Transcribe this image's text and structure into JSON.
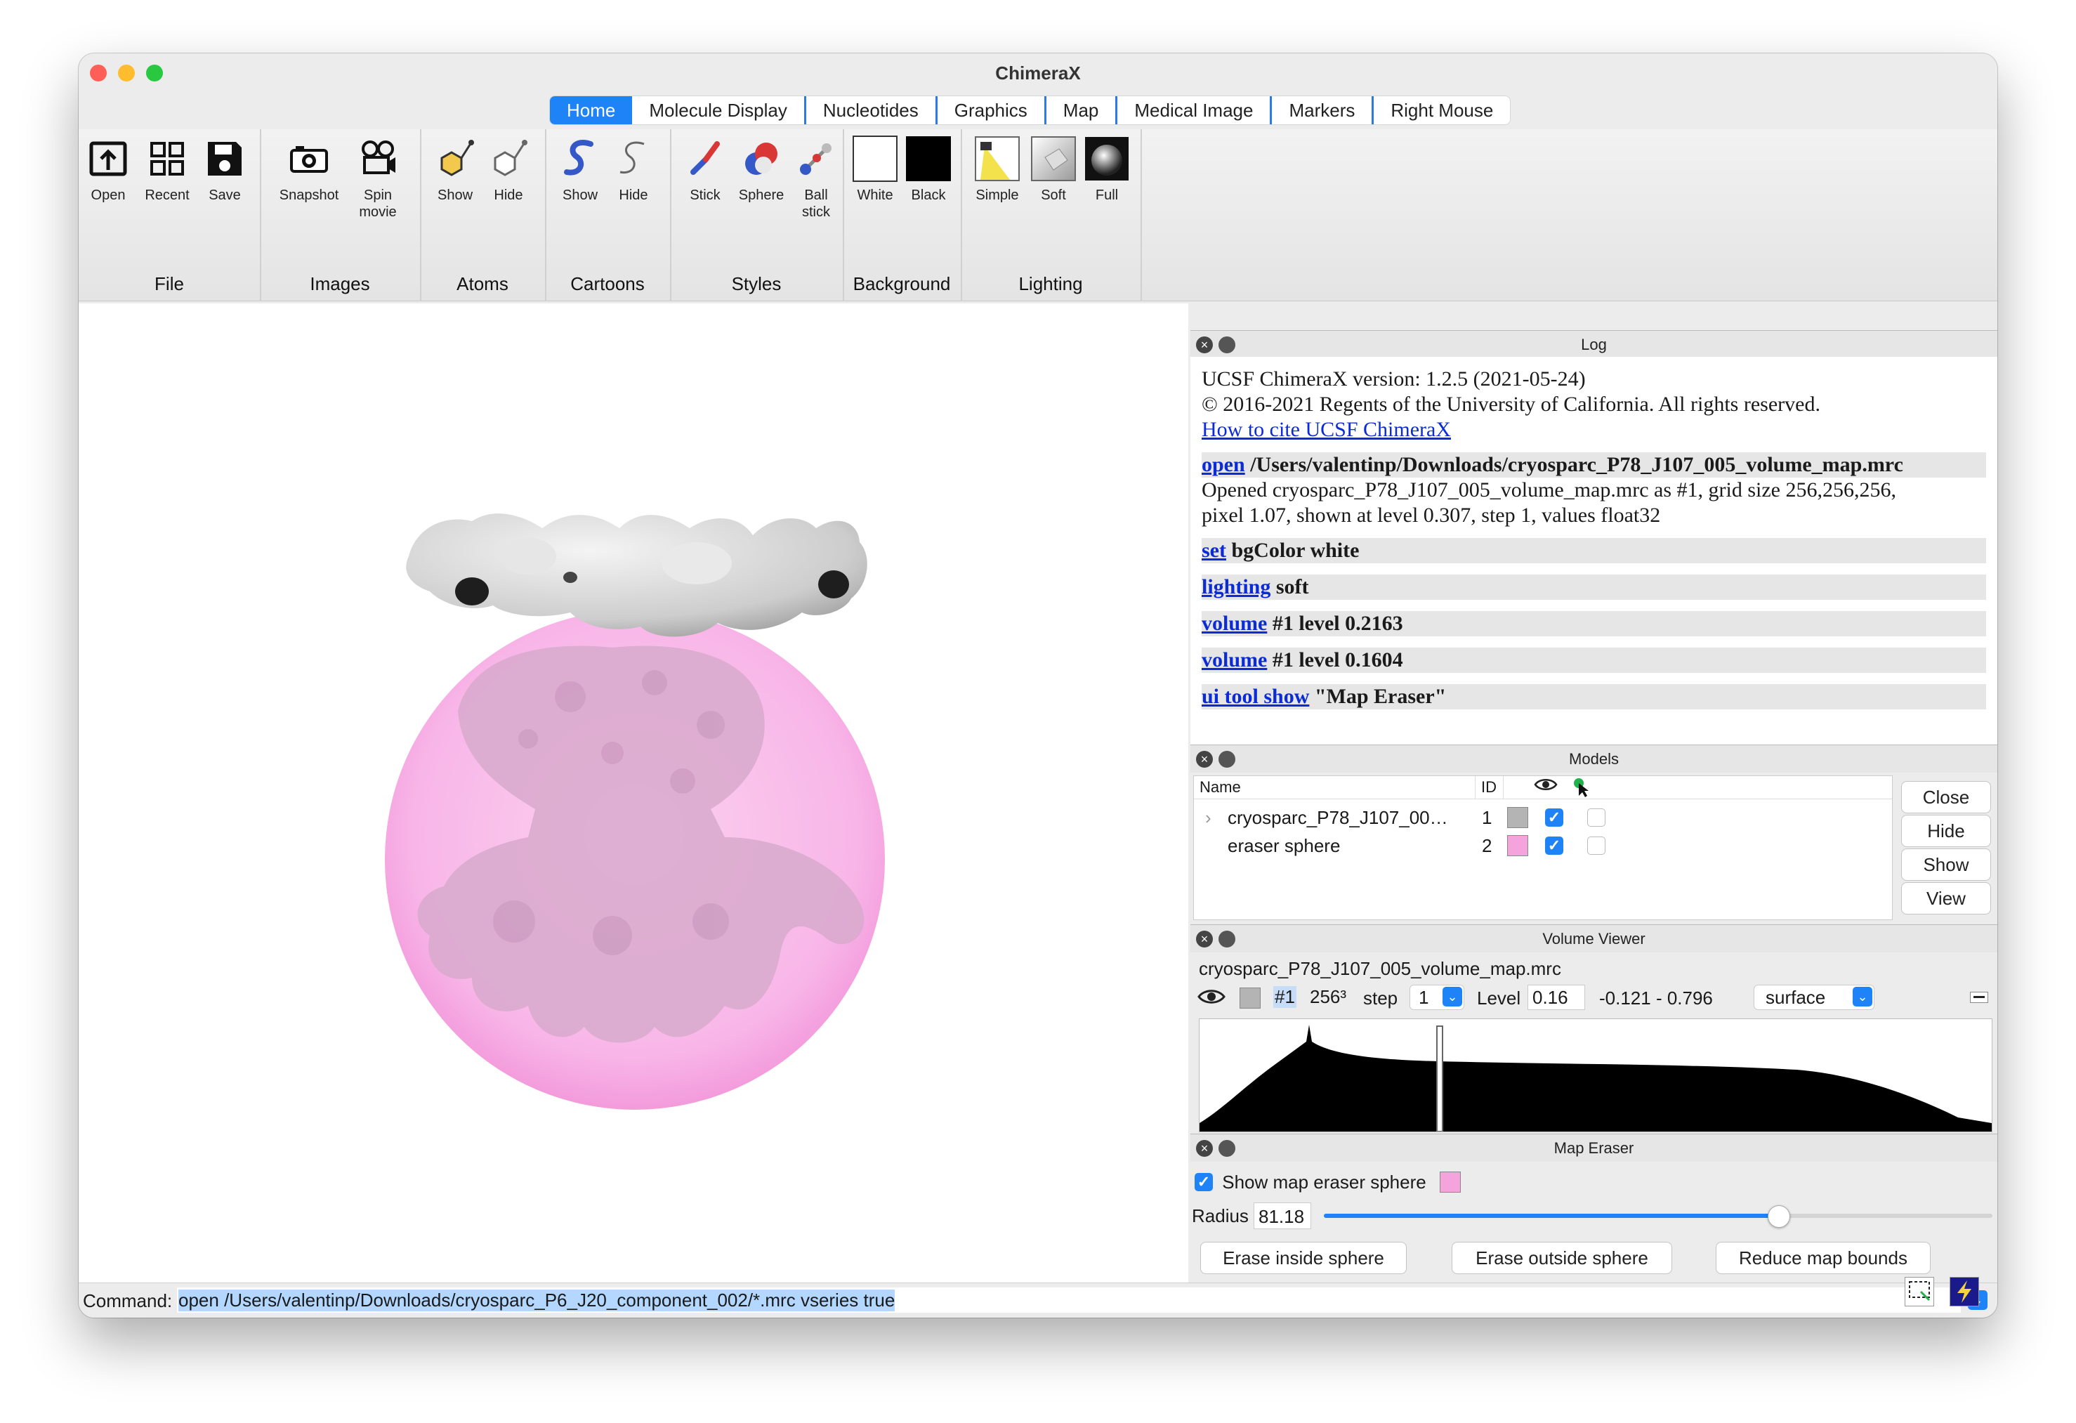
{
  "window": {
    "title": "ChimeraX"
  },
  "tabs": [
    "Home",
    "Molecule Display",
    "Nucleotides",
    "Graphics",
    "Map",
    "Medical Image",
    "Markers",
    "Right Mouse"
  ],
  "ribbon": {
    "groups": {
      "file": "File",
      "images": "Images",
      "atoms": "Atoms",
      "cartoons": "Cartoons",
      "styles": "Styles",
      "background": "Background",
      "lighting": "Lighting"
    },
    "buttons": {
      "open": "Open",
      "recent": "Recent",
      "save": "Save",
      "snapshot": "Snapshot",
      "spin_movie_1": "Spin",
      "spin_movie_2": "movie",
      "atoms_show": "Show",
      "atoms_hide": "Hide",
      "cartoons_show": "Show",
      "cartoons_hide": "Hide",
      "stick": "Stick",
      "sphere": "Sphere",
      "ball_stick_1": "Ball",
      "ball_stick_2": "stick",
      "white": "White",
      "black": "Black",
      "simple": "Simple",
      "soft": "Soft",
      "full": "Full"
    }
  },
  "log": {
    "title": "Log",
    "version": "UCSF ChimeraX version: 1.2.5 (2021-05-24)",
    "copyright": "© 2016-2021 Regents of the University of California. All rights reserved.",
    "cite_link": "How to cite UCSF ChimeraX",
    "entries": [
      {
        "cmd": "open",
        "args": " /Users/valentinp/Downloads/cryosparc_P78_J107_005_volume_map.mrc"
      },
      {
        "cmd": "set",
        "args": " bgColor white"
      },
      {
        "cmd": "lighting",
        "args": " soft"
      },
      {
        "cmd": "volume",
        "args": " #1 level 0.2163"
      },
      {
        "cmd": "volume",
        "args": " #1 level 0.1604"
      },
      {
        "cmd": "ui tool show",
        "args": " \"Map Eraser\""
      }
    ],
    "opened_line1": "Opened cryosparc_P78_J107_005_volume_map.mrc as #1, grid size 256,256,256,",
    "opened_line2": "pixel 1.07, shown at level 0.307, step 1, values float32"
  },
  "models": {
    "title": "Models",
    "headers": {
      "name": "Name",
      "id": "ID"
    },
    "rows": [
      {
        "name": "cryosparc_P78_J107_00…",
        "id": "1",
        "color": "#b4b4b4",
        "shown": true
      },
      {
        "name": "eraser sphere",
        "id": "2",
        "color": "#f5a3dd",
        "shown": true
      }
    ],
    "buttons": {
      "close": "Close",
      "hide": "Hide",
      "show": "Show",
      "view": "View"
    }
  },
  "volume_viewer": {
    "title": "Volume Viewer",
    "filename": "cryosparc_P78_J107_005_volume_map.mrc",
    "model_id": "#1",
    "size": "256³",
    "step_label": "step",
    "step_value": "1",
    "level_label": "Level",
    "level_value": "0.16",
    "range": "-0.121 - 0.796",
    "style": "surface",
    "color": "#b4b4b4"
  },
  "map_eraser": {
    "title": "Map Eraser",
    "show_sphere_label": "Show map eraser sphere",
    "show_sphere_checked": true,
    "sphere_color": "#f5a3dd",
    "radius_label": "Radius",
    "radius_value": "81.18",
    "radius_slider_fraction": 0.68,
    "erase_inside": "Erase inside sphere",
    "erase_outside": "Erase outside sphere",
    "reduce_bounds": "Reduce map bounds"
  },
  "command": {
    "label": "Command:",
    "value": "open /Users/valentinp/Downloads/cryosparc_P6_J20_component_002/*.mrc vseries true"
  },
  "colors": {
    "accent": "#1e83f7",
    "eraser_sphere": "#f5a3dd",
    "link": "#0b2bd6"
  }
}
